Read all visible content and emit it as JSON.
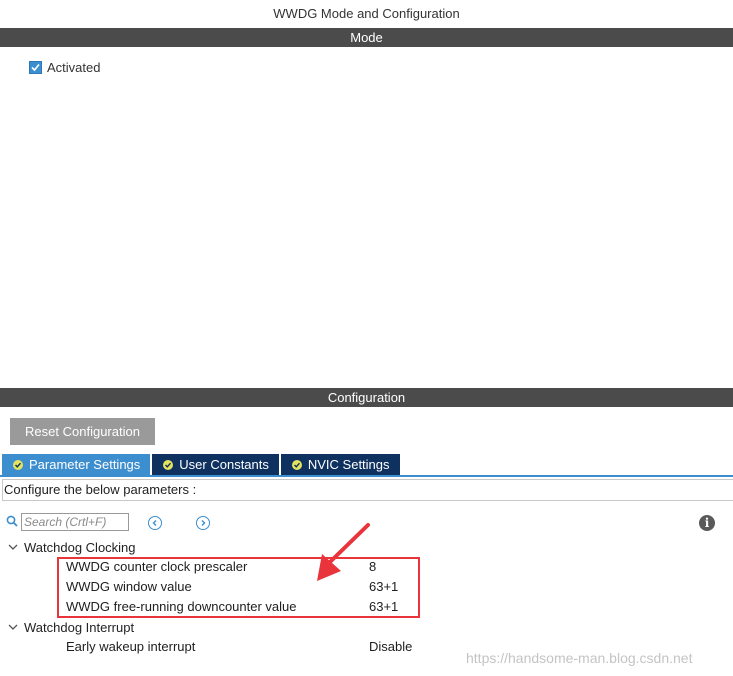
{
  "window": {
    "title": "WWDG Mode and Configuration"
  },
  "mode": {
    "header": "Mode",
    "activated_label": "Activated",
    "activated_checked": true
  },
  "configuration": {
    "header": "Configuration",
    "reset_label": "Reset Configuration",
    "tabs": [
      {
        "label": "Parameter Settings",
        "active": true
      },
      {
        "label": "User Constants",
        "active": false
      },
      {
        "label": "NVIC Settings",
        "active": false
      }
    ],
    "hint": "Configure the below parameters :",
    "search": {
      "placeholder": "Search (Crtl+F)"
    },
    "groups": [
      {
        "label": "Watchdog Clocking",
        "params": [
          {
            "name": "WWDG counter clock prescaler",
            "value": "8"
          },
          {
            "name": "WWDG window value",
            "value": "63+1"
          },
          {
            "name": "WWDG free-running downcounter value",
            "value": "63+1"
          }
        ]
      },
      {
        "label": "Watchdog Interrupt",
        "params": [
          {
            "name": "Early wakeup interrupt",
            "value": "Disable"
          }
        ]
      }
    ]
  },
  "watermark": "https://handsome-man.blog.csdn.net",
  "colors": {
    "header_bar": "#4b4b4b",
    "active_tab": "#3d8ecf",
    "inactive_tab": "#0e3160",
    "highlight": "#e8343a"
  }
}
